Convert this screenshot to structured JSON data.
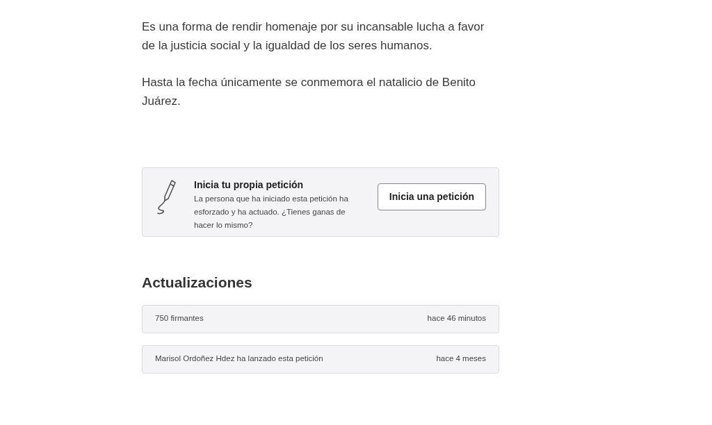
{
  "paragraphs": [
    "Es una forma de rendir homenaje por su incansable lucha a favor de la justicia social y la igualdad de los seres humanos.",
    "Hasta la fecha únicamente se conmemora el natalicio de Benito Juárez."
  ],
  "start_petition": {
    "title": "Inicia tu propia petición",
    "text": "La persona que ha iniciado esta petición ha esforzado y ha actuado. ¿Tienes ganas de hacer lo mismo?",
    "button": "Inicia una petición"
  },
  "updates": {
    "heading": "Actualizaciones",
    "items": [
      {
        "text": "750 firmantes",
        "time": "hace 46 minutos"
      },
      {
        "text": "Marisol Ordoñez Hdez ha lanzado esta petición",
        "time": "hace 4 meses"
      }
    ]
  }
}
